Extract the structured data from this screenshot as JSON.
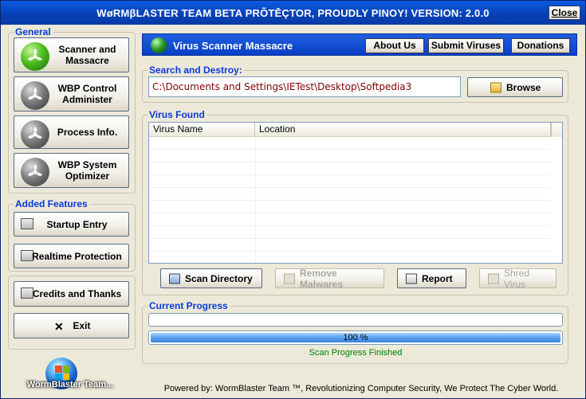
{
  "window": {
    "title": "WøRMβLASTER TEAM BETA PRÕTĒÇTOR, PROUDLY PINOY! VERSION: 2.0.0",
    "close_label": "Close"
  },
  "sidebar": {
    "general_label": "General",
    "general_items": [
      {
        "label": "Scanner and Massacre",
        "icon": "green-fan-orb-icon"
      },
      {
        "label": "WBP Control Administer",
        "icon": "gray-fan-orb-icon"
      },
      {
        "label": "Process Info.",
        "icon": "gray-fan-orb-icon"
      },
      {
        "label": "WBP System Optimizer",
        "icon": "gray-fan-orb-icon"
      }
    ],
    "added_label": "Added Features",
    "added_items": [
      {
        "label": "Startup Entry",
        "icon": "window-icon"
      },
      {
        "label": "Realtime Protection",
        "icon": "window-icon"
      }
    ],
    "other_items": [
      {
        "label": "Credits and Thanks",
        "icon": "window-icon"
      },
      {
        "label": "Exit",
        "icon": "x-icon"
      }
    ],
    "logo_text": "WormBlaster Team..."
  },
  "header": {
    "title": "Virus Scanner Massacre",
    "buttons": [
      "About Us",
      "Submit Viruses",
      "Donations"
    ]
  },
  "search": {
    "label": "Search and Destroy:",
    "path": "C:\\Documents and Settings\\IETest\\Desktop\\Softpedia3",
    "browse_label": "Browse"
  },
  "virus_found": {
    "label": "Virus Found",
    "columns": [
      "Virus Name",
      "Location"
    ]
  },
  "actions": {
    "scan_label": "Scan Directory",
    "remove_label": "Remove Malwares",
    "report_label": "Report",
    "shred_label": "Shred Virus"
  },
  "progress": {
    "label": "Current Progress",
    "percent_text": "100 %",
    "percent_value": 100,
    "status": "Scan Progress Finished"
  },
  "footer": "Powered by: WormBlaster Team ™, Revolutionizing Computer Security, We Protect The Cyber World."
}
